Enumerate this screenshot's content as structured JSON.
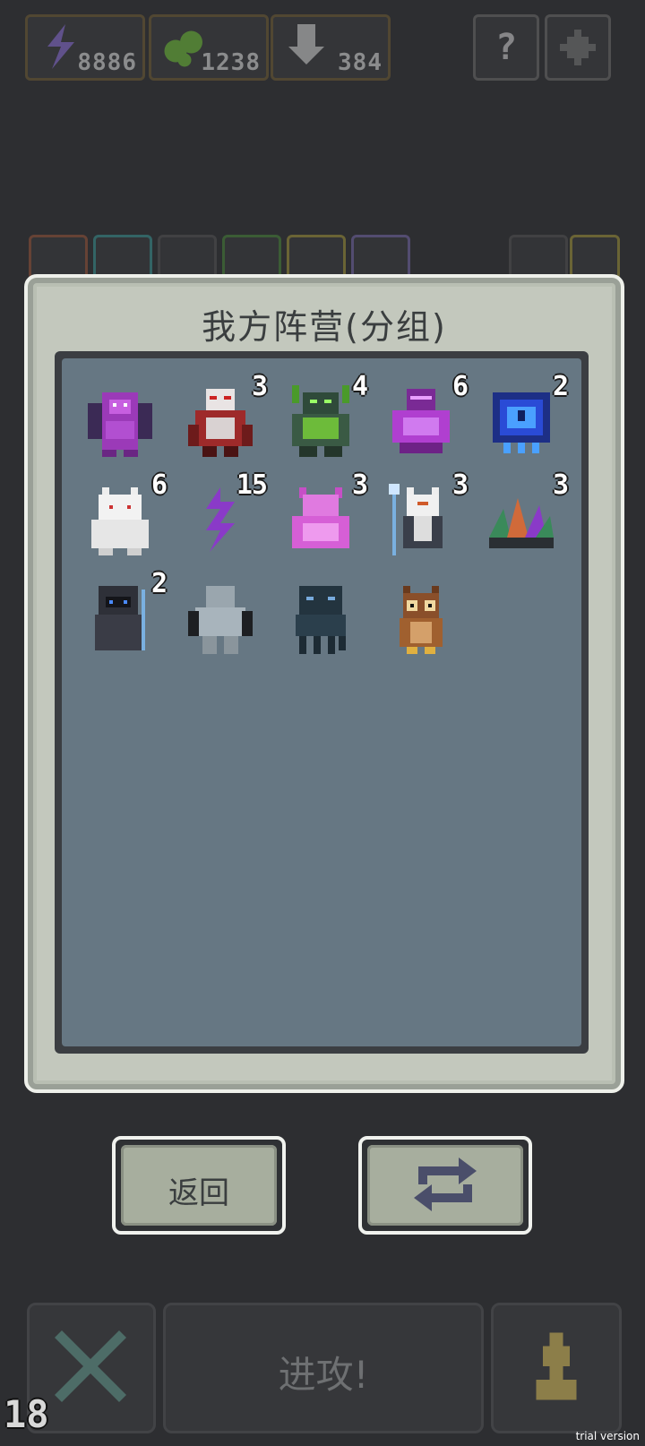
{
  "resources": [
    {
      "name": "energy",
      "value": "8886",
      "icon": "lightning-icon",
      "color": "#8a6fd6"
    },
    {
      "name": "mana",
      "value": "1238",
      "icon": "bubbles-icon",
      "color": "#6fbf3a"
    },
    {
      "name": "download",
      "value": "384",
      "icon": "down-arrow-icon",
      "color": "#d0d0d0"
    }
  ],
  "top_buttons": {
    "help": "?",
    "settings_icon": "gear-icon"
  },
  "modal": {
    "title": "我方阵营(分组)",
    "units": [
      {
        "name": "purple-dragon",
        "count": ""
      },
      {
        "name": "red-armored-demon",
        "count": "3"
      },
      {
        "name": "green-horned-golem",
        "count": "4"
      },
      {
        "name": "purple-crystal-beast",
        "count": "6"
      },
      {
        "name": "blue-clock-cube",
        "count": "2"
      },
      {
        "name": "white-ghost-cat",
        "count": "6"
      },
      {
        "name": "purple-lightning-spirit",
        "count": "15"
      },
      {
        "name": "pink-imp",
        "count": "3"
      },
      {
        "name": "white-fox-sage",
        "count": "3"
      },
      {
        "name": "crystal-plant",
        "count": "3"
      },
      {
        "name": "hooded-dark-mage",
        "count": "2"
      },
      {
        "name": "grey-ghoul",
        "count": ""
      },
      {
        "name": "dark-tentacle-beast",
        "count": ""
      },
      {
        "name": "brown-owl",
        "count": ""
      }
    ]
  },
  "buttons": {
    "back": "返回",
    "swap_icon": "swap-arrows-icon"
  },
  "bottom_bar": {
    "attack": "进攻!",
    "level": "18",
    "close_icon": "x-icon",
    "pawn_icon": "pawn-icon"
  },
  "watermark": "trial version"
}
